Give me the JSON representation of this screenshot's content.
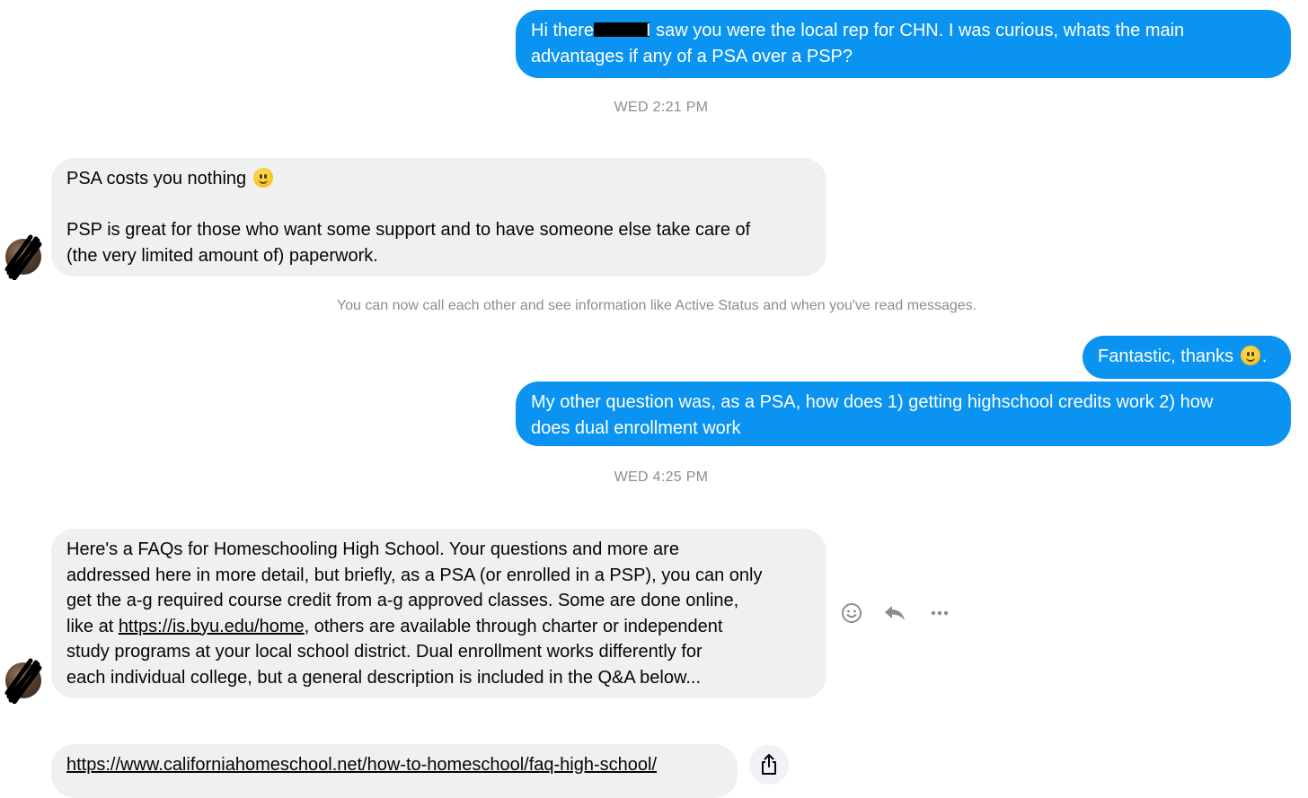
{
  "messages": {
    "m1": {
      "line1_before": "Hi there",
      "line1_after": "I saw you were the local rep for CHN. I was curious, whats the main",
      "line2": "advantages if any of a PSA over a PSP?"
    },
    "ts1": "WED 2:21 PM",
    "m2": {
      "line1": "PSA costs you nothing",
      "line3": "PSP is great for those who want some support and to have someone else take care of",
      "line4": "(the very limited amount of) paperwork."
    },
    "system_notice": "You can now call each other and see information like Active Status and when you've read messages.",
    "m3": {
      "text": "Fantastic, thanks",
      "suffix": "."
    },
    "m4": {
      "line1": "My other question was, as a PSA, how does 1) getting highschool credits work 2) how",
      "line2": "does dual enrollment work"
    },
    "ts2": "WED 4:25 PM",
    "m5": {
      "line1": "Here's a FAQs for Homeschooling High School.  Your questions and more are",
      "line2": "addressed here in more detail, but briefly, as a PSA (or enrolled in a PSP), you can only",
      "line3": "get the a-g required course credit from a-g approved classes.  Some are done online,",
      "line4_prefix": "like at ",
      "line4_link": "https://is.byu.edu/home",
      "line4_suffix": ", others are available through charter or independent",
      "line5": "study programs at your local school district.  Dual enrollment works differently for",
      "line6": "each individual college, but a general description is included in the Q&A below..."
    },
    "m6": {
      "link": "https://www.californiahomeschool.net/how-to-homeschool/faq-high-school/"
    }
  },
  "icons": {
    "react": "smiley-face-icon",
    "reply": "reply-arrow-icon",
    "more": "more-dots-icon",
    "share": "share-icon",
    "emoji": "slightly-smiling-face-emoji"
  },
  "colors": {
    "outgoing_bubble": "#0a93f0",
    "incoming_bubble": "#f0f0f0",
    "meta_text": "#8a8d91"
  }
}
